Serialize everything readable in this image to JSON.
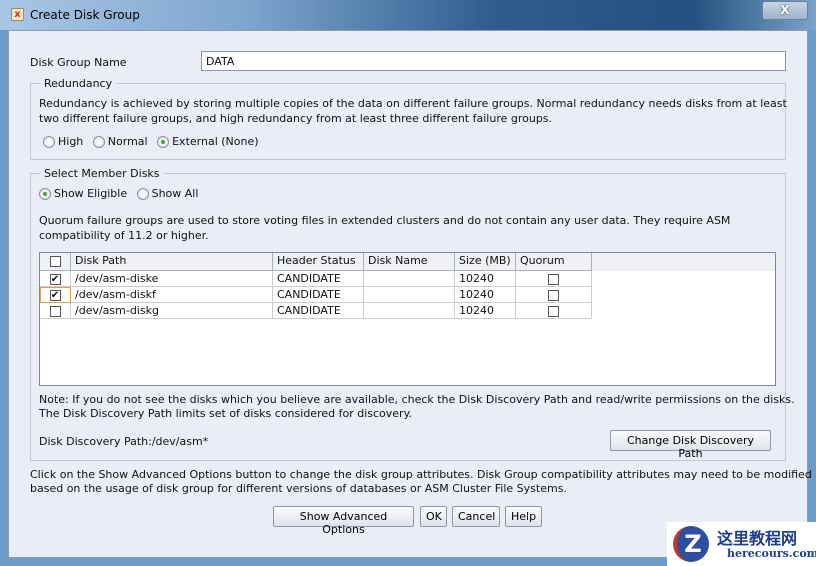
{
  "window": {
    "title": "Create Disk Group",
    "close_label": "X"
  },
  "disk_group_name": {
    "label": "Disk Group Name",
    "value": "DATA"
  },
  "redundancy": {
    "legend": "Redundancy",
    "description_line1": "Redundancy is achieved by storing multiple copies of the data on different failure groups. Normal redundancy needs disks from at least",
    "description_line2": "two different failure groups, and high redundancy from at least three different failure groups.",
    "options": [
      {
        "label": "High",
        "selected": false
      },
      {
        "label": "Normal",
        "selected": false
      },
      {
        "label": "External (None)",
        "selected": true
      }
    ]
  },
  "member_disks": {
    "legend": "Select Member Disks",
    "filter_options": [
      {
        "label": "Show Eligible",
        "selected": true
      },
      {
        "label": "Show All",
        "selected": false
      }
    ],
    "quorum_note_line1": "Quorum failure groups are used to store voting files in extended clusters and do not contain any user data. They require ASM",
    "quorum_note_line2": "compatibility of 11.2 or higher.",
    "columns": [
      "Disk Path",
      "Header Status",
      "Disk Name",
      "Size (MB)",
      "Quorum"
    ],
    "rows": [
      {
        "selected": true,
        "path": "/dev/asm-diske",
        "status": "CANDIDATE",
        "name": "",
        "size": "10240",
        "quorum": false
      },
      {
        "selected": true,
        "path": "/dev/asm-diskf",
        "status": "CANDIDATE",
        "name": "",
        "size": "10240",
        "quorum": false
      },
      {
        "selected": false,
        "path": "/dev/asm-diskg",
        "status": "CANDIDATE",
        "name": "",
        "size": "10240",
        "quorum": false
      }
    ],
    "note_line1": "Note: If you do not see the disks which you believe are available, check the Disk Discovery Path and read/write permissions on the disks.",
    "note_line2": "The Disk Discovery Path limits set of disks considered for discovery.",
    "discovery_path": "Disk Discovery Path:/dev/asm*",
    "change_path_label": "Change Disk Discovery Path"
  },
  "advanced_note_line1": "Click on the Show Advanced Options button to change the disk group attributes. Disk Group compatibility attributes may need to be modified",
  "advanced_note_line2": "based on the usage of disk group for different versions of databases or ASM Cluster File Systems.",
  "buttons": {
    "advanced": "Show Advanced Options",
    "ok": "OK",
    "cancel": "Cancel",
    "help": "Help"
  },
  "watermark": {
    "title": "这里教程网",
    "url": "herecours.com"
  }
}
